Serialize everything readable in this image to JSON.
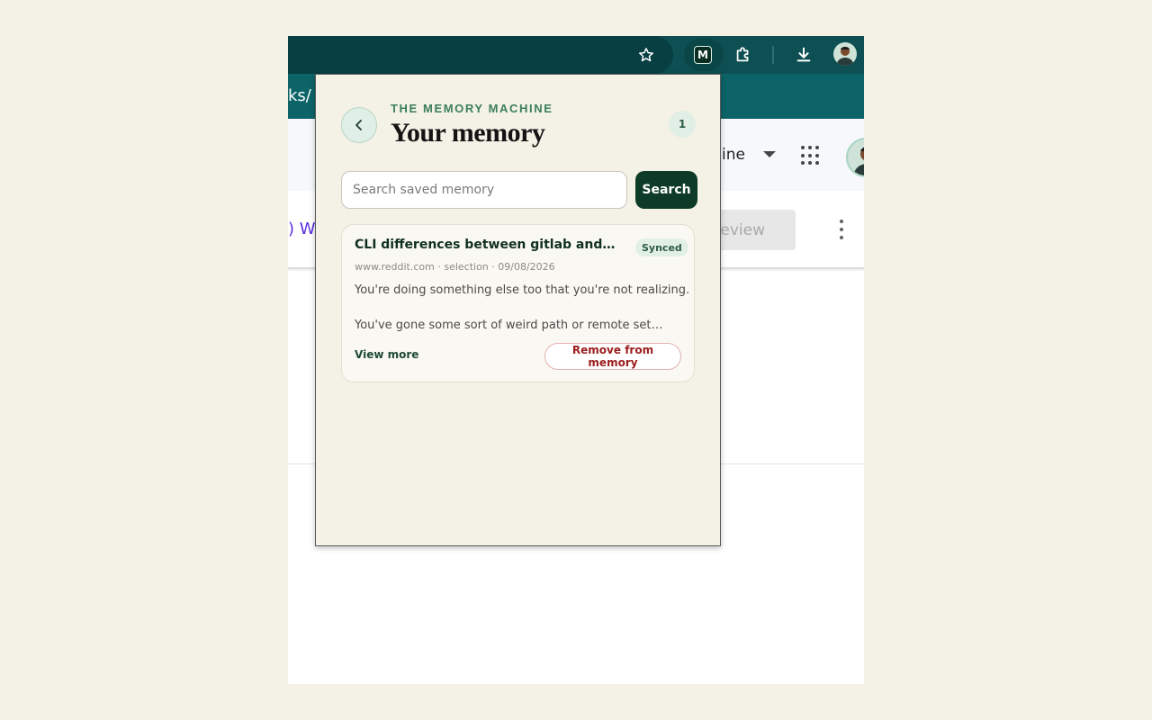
{
  "browser": {
    "url_fragment": "ks/",
    "left_fragment": ") W",
    "appbar_text": "ine",
    "preview_label": "review",
    "icons": [
      "star-icon",
      "memory-machine-extension-icon",
      "extensions-puzzle-icon",
      "download-icon",
      "profile-avatar",
      "apps-grid-icon",
      "more-vert-icon",
      "dropdown-caret-icon"
    ]
  },
  "popup": {
    "eyebrow": "THE MEMORY MACHINE",
    "title": "Your memory",
    "count": "1",
    "search": {
      "placeholder": "Search saved memory",
      "value": "",
      "button_label": "Search"
    },
    "items": [
      {
        "title": "CLI differences between gitlab and git...",
        "status": "Synced",
        "meta": "www.reddit.com · selection · 09/08/2026",
        "line1": "You're doing something else too that you're not realizing.",
        "line2": "You've gone some sort of weird path or remote setup ...",
        "view_more_label": "View more",
        "remove_label": "Remove from memory"
      }
    ]
  },
  "colors": {
    "toolbar": "#0d4f52",
    "accent_green": "#0d3b27",
    "eyebrow_green": "#3a7e5c",
    "remove_red": "#9b1c1c",
    "popup_bg": "#f4f1e6"
  }
}
